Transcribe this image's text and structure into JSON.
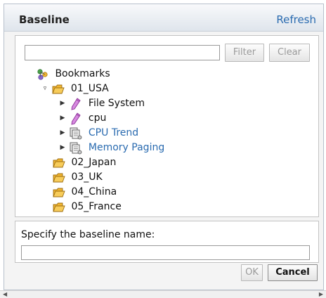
{
  "dialog": {
    "title": "Baseline",
    "refresh_label": "Refresh"
  },
  "filter": {
    "input_value": "",
    "filter_label": "Filter",
    "clear_label": "Clear"
  },
  "tree": {
    "root": {
      "label": "Bookmarks",
      "icon": "bookmarks-icon"
    },
    "folders": [
      {
        "label": "01_USA",
        "icon": "folder-icon",
        "expanded": true,
        "children": [
          {
            "label": "File System",
            "icon": "pencil-icon",
            "type": "bookmark"
          },
          {
            "label": "cpu",
            "icon": "pencil-icon",
            "type": "bookmark"
          },
          {
            "label": "CPU Trend",
            "icon": "report-icon",
            "type": "report"
          },
          {
            "label": "Memory Paging",
            "icon": "report-icon",
            "type": "report"
          }
        ]
      },
      {
        "label": "02_Japan",
        "icon": "folder-icon"
      },
      {
        "label": "03_UK",
        "icon": "folder-icon"
      },
      {
        "label": "04_China",
        "icon": "folder-icon"
      },
      {
        "label": "05_France",
        "icon": "folder-icon"
      }
    ]
  },
  "baseline_name": {
    "caption": "Specify the baseline name:",
    "value": ""
  },
  "buttons": {
    "ok_label": "OK",
    "cancel_label": "Cancel"
  },
  "colors": {
    "link": "#2a6bb0",
    "folder": "#f2b630",
    "pencil": "#b94fc0"
  }
}
